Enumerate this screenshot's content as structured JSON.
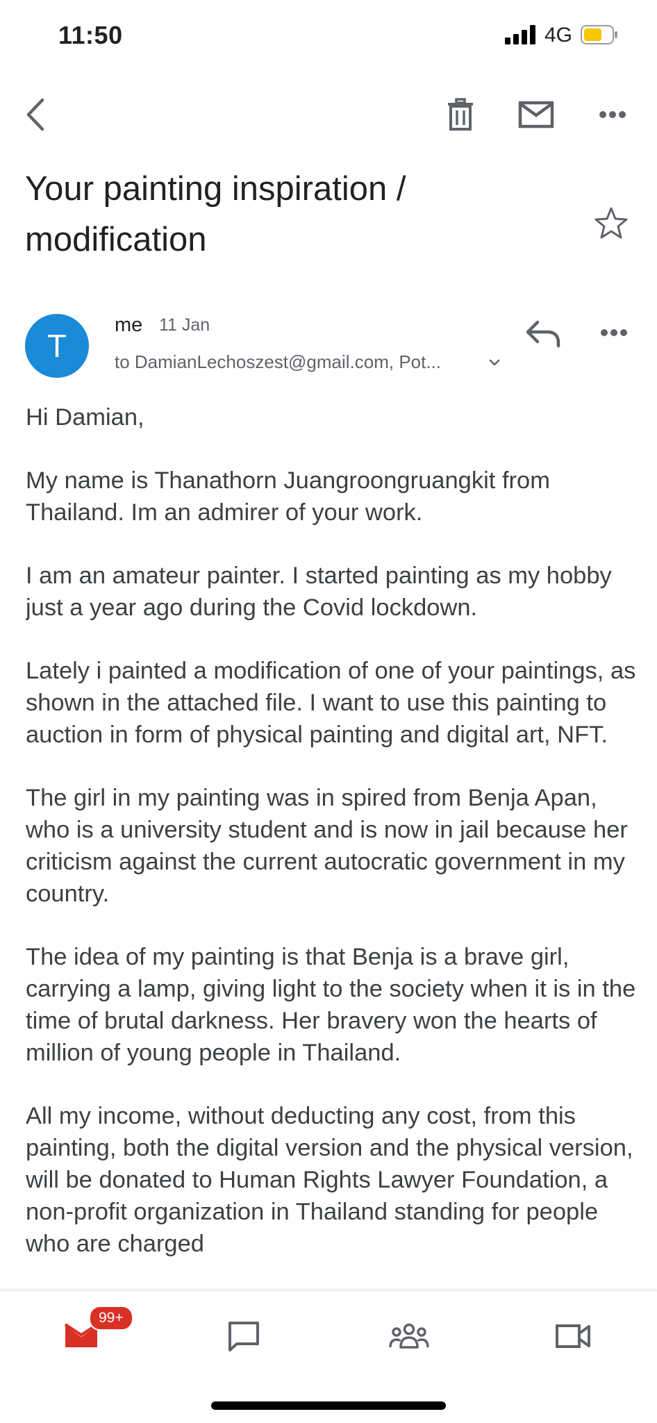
{
  "status_bar": {
    "time": "11:50",
    "network": "4G",
    "battery_color": "#f7c600"
  },
  "toolbar": {
    "back_icon": "chevron-left-icon",
    "delete_icon": "trash-icon",
    "mark_unread_icon": "mail-icon",
    "more_icon": "more-horizontal-icon"
  },
  "email": {
    "subject": "Your painting inspiration / modification",
    "starred": false,
    "sender_initial": "T",
    "avatar_color": "#1a8ad9",
    "sender": "me",
    "date": "11 Jan",
    "recipients": "to DamianLechoszest@gmail.com, Pot...",
    "paragraphs": [
      "Hi Damian,",
      "My name is Thanathorn Juangroongruangkit from Thailand. Im an admirer of your work.",
      "I am an amateur painter. I started painting as my hobby just a year ago during the Covid lockdown.",
      "Lately i painted a modification of one of your paintings, as shown in the attached file. I want to use this painting to auction in form of physical painting and digital art, NFT.",
      "The girl in my painting was in spired from Benja Apan, who is a university student and is now in jail because her criticism against the current autocratic government in my country.",
      "The idea of my painting is that Benja is a brave girl, carrying a lamp, giving light to the society when it is in the time of brutal darkness. Her bravery won the hearts of million of young people in Thailand.",
      "All my income, without deducting any cost, from this painting, both the digital version and the physical version, will be donated to Human Rights Lawyer Foundation, a non-profit organization in Thailand standing for people who are charged"
    ]
  },
  "bottom_nav": {
    "mail_badge": "99+",
    "mail_icon": "mail-icon",
    "chat_icon": "chat-icon",
    "spaces_icon": "people-icon",
    "meet_icon": "video-icon",
    "mail_color": "#d93025"
  }
}
